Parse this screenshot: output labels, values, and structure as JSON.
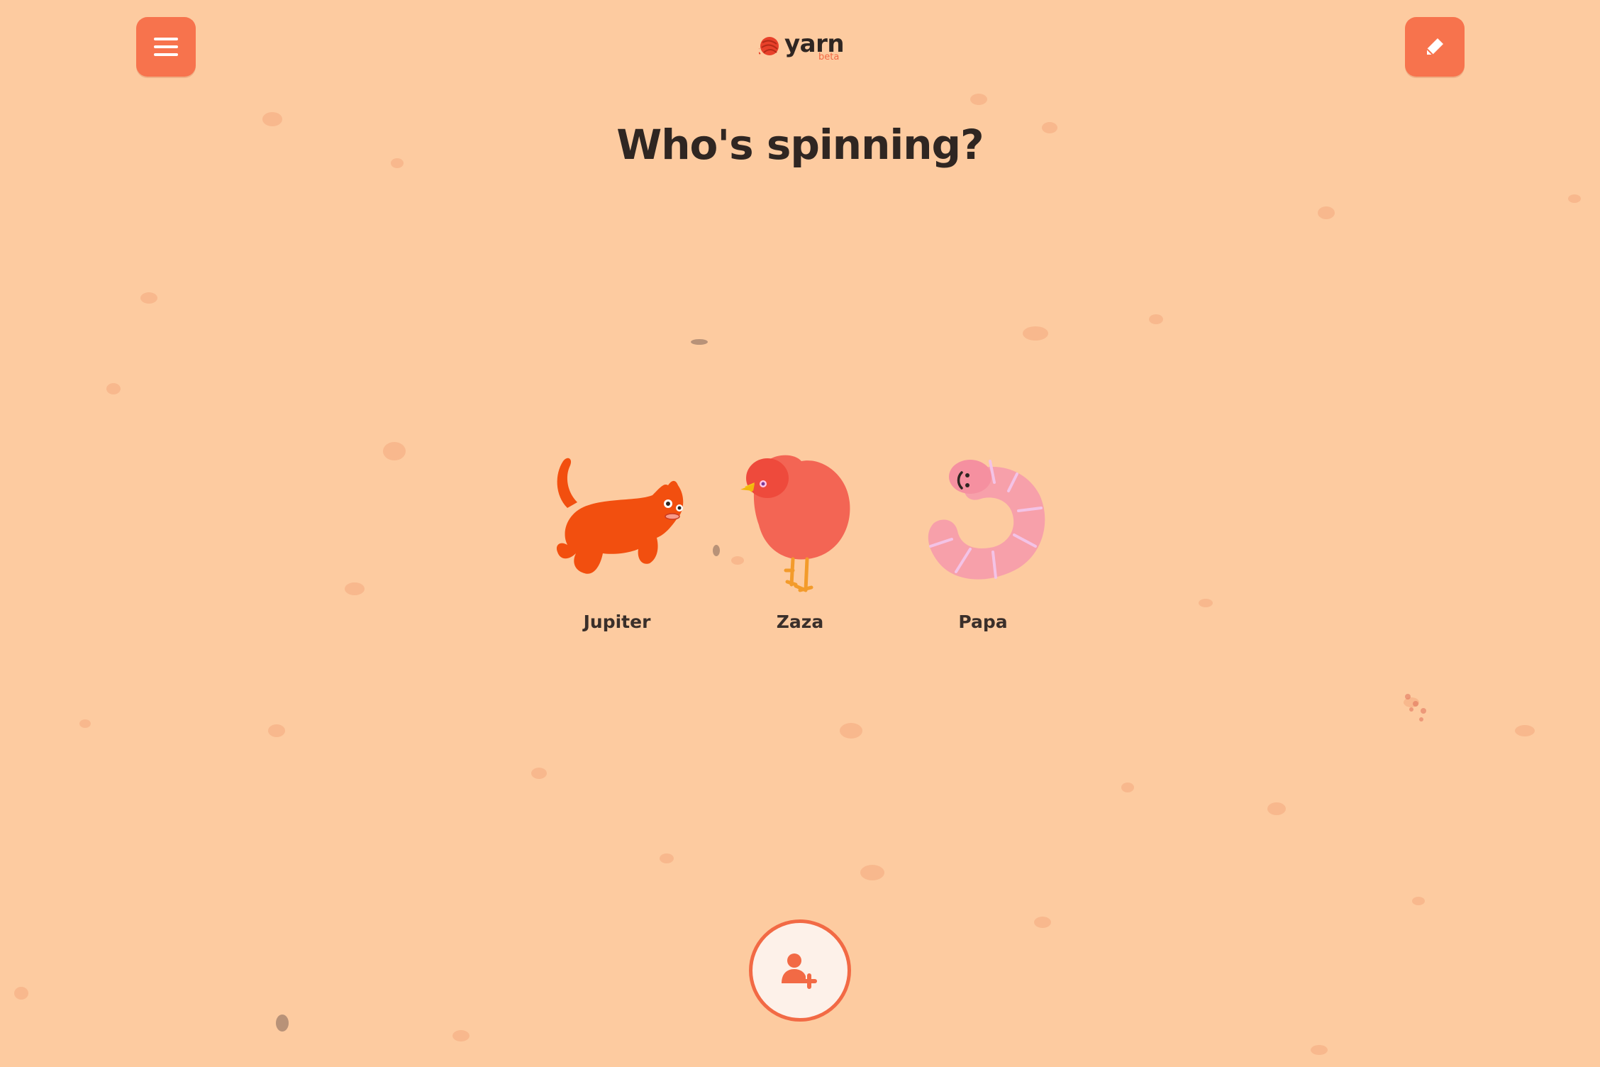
{
  "app": {
    "brand_name": "yarn",
    "brand_tag": "beta"
  },
  "header": {
    "menu_icon": "hamburger-menu-icon",
    "edit_icon": "pencil-icon"
  },
  "main": {
    "title": "Who's spinning?",
    "profiles": [
      {
        "name": "Jupiter",
        "avatar": "orange-cat-avatar"
      },
      {
        "name": "Zaza",
        "avatar": "red-bird-avatar"
      },
      {
        "name": "Papa",
        "avatar": "pink-worm-avatar"
      }
    ]
  },
  "footer": {
    "add_profile_icon": "add-user-icon"
  },
  "colors": {
    "background": "#fdcba0",
    "accent": "#f7734d",
    "title_text": "#2f2622",
    "name_text": "#3a2f2a",
    "logo_red": "#e8412a",
    "button_fill": "#fdf1e9"
  }
}
